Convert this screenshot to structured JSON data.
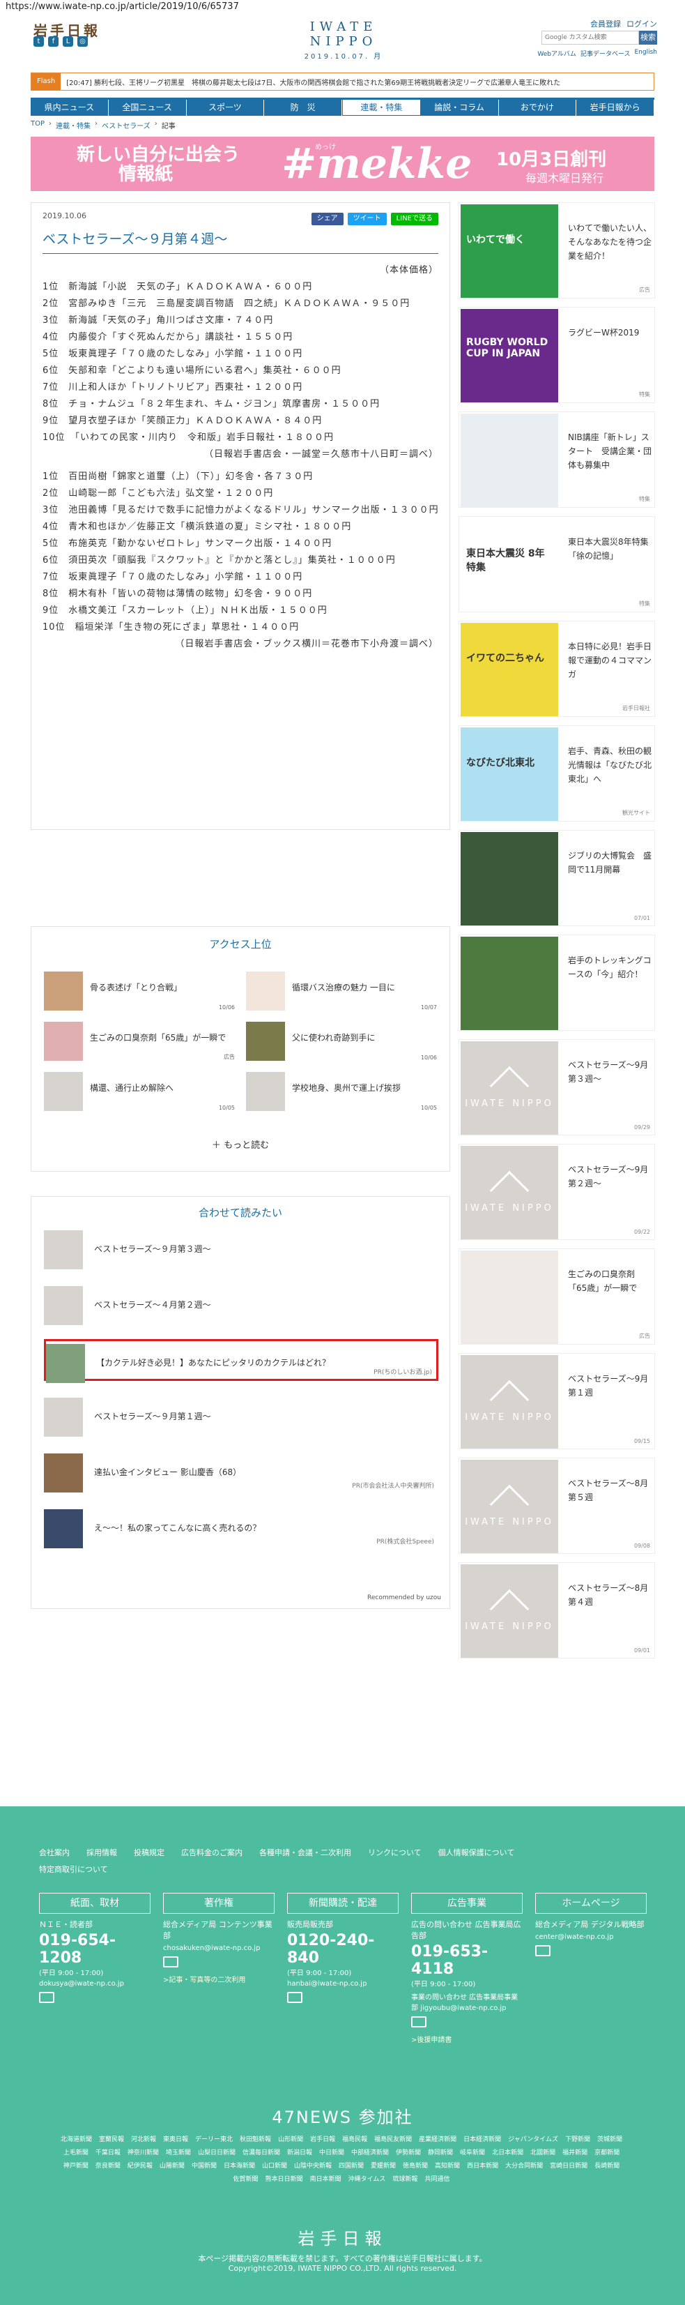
{
  "url": "https://www.iwate-np.co.jp/article/2019/10/6/65737",
  "header": {
    "logo_left": "岩手日報",
    "logo_center": "IWATE NIPPO",
    "date_line": "2019.10.07. 月",
    "register": "会員登録",
    "login": "ログイン",
    "search_placeholder": "Google カスタム検索",
    "search_button": "検索",
    "web_album": "Webアルバム",
    "news_db": "記事データベース",
    "eng": "English"
  },
  "ticker": {
    "label": "Flash",
    "time": "[20:47]",
    "text": "勝利七段、王将リーグ初黒星　将棋の藤井聡太七段は7日、大阪市の関西将棋会館で指された第69期王将戦挑戦者決定リーグで広瀬章人竜王に敗れた"
  },
  "nav": [
    "県内ニュース",
    "全国ニュース",
    "スポーツ",
    "防　災",
    "連載・特集",
    "論説・コラム",
    "おでかけ",
    "岩手日報から"
  ],
  "breadcrumb": [
    "TOP",
    "連載・特集",
    "ベストセラーズ",
    "記事"
  ],
  "banner": {
    "left1": "新しい自分に出会う",
    "left2": "情報紙",
    "mekke": "#mekke",
    "mekke_kana": "めっけ",
    "right": "10月3日創刊",
    "right2": "毎週木曜日発行"
  },
  "article": {
    "date": "2019.10.06",
    "share_fb": "シェア",
    "share_tw": "ツイート",
    "share_line": "LINEで送る",
    "title": "ベストセラーズ～９月第４週～",
    "note": "（本体価格）",
    "lines_a": [
      "1位　新海誠「小説　天気の子」ＫＡＤＯＫＡＷＡ・６００円",
      "2位　宮部みゆき「三元　三島屋変調百物語　四之続」ＫＡＤＯＫＡＷＡ・９５０円",
      "3位　新海誠「天気の子」角川つばさ文庫・７４０円",
      "4位　内藤俊介「すぐ死ぬんだから」講談社・１５５０円",
      "5位　坂東眞理子「７０歳のたしなみ」小学館・１１００円",
      "6位　矢部和幸「どこよりも遠い場所にいる君へ」集英社・６００円",
      "7位　川上和人ほか「トリノトリビア」西東社・１２００円",
      "8位　チョ・ナムジュ「８２年生まれ、キム・ジヨン」筑摩書房・１５００円",
      "9位　望月衣塑子ほか「笑顔正力」ＫＡＤＯＫＡＷＡ・８４０円",
      "10位　「いわての民家・川内り　令和版」岩手日報社・１８００円"
    ],
    "source_a": "（日報岩手書店会・一誠堂＝久慈市十八日町＝調べ）",
    "lines_b": [
      "1位　百田尚樹「錦家と道璽（上）（下）」幻冬舎・各７３０円",
      "2位　山崎聡一郎「こども六法」弘文堂・１２００円",
      "3位　池田義博「見るだけで数手に記憶力がよくなるドリル」サンマーク出版・１３００円",
      "4位　青木和也ほか／佐藤正文「横浜鉄道の夏」ミシマ社・１８００円",
      "5位　布施英克「勤かないゼロトレ」サンマーク出版・１４００円",
      "6位　須田英次「頭脳我『スクワット』と『かかと落とし』」集英社・１０００円",
      "7位　坂東眞理子「７０歳のたしなみ」小学館・１１００円",
      "8位　桐木有朴「皆いの荷物は薄情の眩物」幻冬舎・９００円",
      "9位　水橋文美江「スカーレット（上）」ＮＨＫ出版・１５００円",
      "10位　稲垣栄洋「生き物の死にざま」草思社・１４００円"
    ],
    "source_b": "（日報岩手書店会・ブックス横川＝花巻市下小舟渡＝調べ）"
  },
  "sidebar": [
    {
      "title": "いわてで働いたい人、そんなあなたを待つ企業を紹介！",
      "src": "広告",
      "bg": "#2f9e4a",
      "img_text": "いわてで働く"
    },
    {
      "title": "ラグビーW杯2019",
      "src": "特集",
      "bg": "#6a2a8c",
      "img_text": "RUGBY WORLD CUP IN JAPAN"
    },
    {
      "title": "NIB講座「新トレ」スタート　受講企業・団体も募集中",
      "src": "特集",
      "bg": "#e9eef3",
      "img_text": ""
    },
    {
      "title": "東日本大震災8年特集「徐の記憶」",
      "src": "特集",
      "bg": "#ffffff",
      "img_text": "東日本大震災 8年特集"
    },
    {
      "title": "本日特に必見！岩手日報で運動の４コママンガ",
      "src": "岩手日報社",
      "bg": "#f0d93a",
      "img_text": "イワての二ちゃん"
    },
    {
      "title": "岩手、青森、秋田の観光情報は「なびたび北東北」へ",
      "src": "観光サイト",
      "bg": "#aee0f2",
      "img_text": "なびたび北東北"
    },
    {
      "title": "ジブリの大博覧会　盛岡で11月開幕",
      "src": "07/01",
      "bg": "#3a5a3a",
      "img_text": ""
    },
    {
      "title": "岩手のトレッキングコースの「今」紹介！",
      "src": "",
      "bg": "#4d7a3e",
      "img_text": ""
    },
    {
      "title": "ベストセラーズ～9月第３週～",
      "src": "09/29",
      "bg": "",
      "img_text": "IWATE NIPPO"
    },
    {
      "title": "ベストセラーズ～9月第２週～",
      "src": "09/22",
      "bg": "",
      "img_text": "IWATE NIPPO"
    },
    {
      "title": "生ごみの口臭奈剤「65歳」が一瞬で",
      "src": "広告",
      "bg": "#efeae6",
      "img_text": ""
    },
    {
      "title": "ベストセラーズ～9月第１週",
      "src": "09/15",
      "bg": "",
      "img_text": "IWATE NIPPO"
    },
    {
      "title": "ベストセラーズ～8月第５週",
      "src": "09/08",
      "bg": "",
      "img_text": "IWATE NIPPO"
    },
    {
      "title": "ベストセラーズ～8月第４週",
      "src": "09/01",
      "bg": "",
      "img_text": "IWATE NIPPO"
    }
  ],
  "access": {
    "title": "アクセス上位",
    "items": [
      {
        "t": "骨る表述げ「とり合戦」",
        "d": "10/06"
      },
      {
        "t": "循環バス治療の魅力 一目に",
        "d": "10/07"
      },
      {
        "t": "生ごみの口臭奈剤「65歳」が一瞬で",
        "d": "広告"
      },
      {
        "t": "父に使われ奇跡到手に",
        "d": "10/06"
      },
      {
        "t": "構還、通行止め解除へ",
        "d": "10/05"
      },
      {
        "t": "学校地身、奥州で運上げ挨拶",
        "d": "10/05"
      }
    ],
    "more": "もっと読む"
  },
  "related": {
    "title": "合わせて読みたい",
    "items": [
      {
        "t": "ベストセラーズ～９月第３週～",
        "pr": ""
      },
      {
        "t": "ベストセラーズ～４月第２週～",
        "pr": ""
      },
      {
        "t": "【カクテル好き必見！】あなたにピッタリのカクテルはどれ？",
        "pr": "PR(ちのしいお酒.jp)"
      },
      {
        "t": "ベストセラーズ～９月第１週～",
        "pr": ""
      },
      {
        "t": "達払い金インタビュー 影山慶香（68）",
        "pr": "PR(市会会社法人中央審判所)"
      },
      {
        "t": "え～～！私の家ってこんなに高く売れるの？",
        "pr": "PR(株式会社Speee)"
      }
    ],
    "rec": "Recommended by uzou"
  },
  "footer": {
    "links": [
      "会社案内",
      "採用情報",
      "投稿規定",
      "広告料金のご案内",
      "各種申請・会議・二次利用",
      "リンクについて",
      "個人情報保護について",
      "特定商取引について"
    ],
    "cols": [
      {
        "h": "紙面、取材",
        "s": "ＮＩＥ・読者部",
        "ph": "019-654-1208",
        "t": "(平日 9:00 - 17:00)",
        "em": "dokusya@iwate-np.co.jp",
        "lk": ""
      },
      {
        "h": "著作権",
        "s": "総合メディア局 コンテンツ事業部",
        "ph": "",
        "t": "",
        "em": "chosakuken@iwate-np.co.jp",
        "lk": ">記事・写真等の二次利用"
      },
      {
        "h": "新聞購読・配達",
        "s": "販売局販売部",
        "ph": "0120-240-840",
        "t": "(平日 9:00 - 17:00)",
        "em": "hanbai@iwate-np.co.jp",
        "lk": ""
      },
      {
        "h": "広告事業",
        "s": "広告の問い合わせ 広告事業局広告部",
        "ph": "019-653-4118",
        "t": "(平日 9:00 - 17:00)",
        "em": "事業の問い合わせ 広告事業局事業部 jigyoubu@iwate-np.co.jp",
        "lk": ">後援申請書"
      },
      {
        "h": "ホームページ",
        "s": "総合メディア局 デジタル戦略部",
        "ph": "",
        "t": "",
        "em": "center@iwate-np.co.jp",
        "lk": ""
      }
    ],
    "n47": "47NEWS 参加社",
    "papers": [
      "北海道新聞",
      "室蘭民報",
      "河北新報",
      "東奥日報",
      "デーリー東北",
      "秋田魁新報",
      "山形新聞",
      "岩手日報",
      "福島民報",
      "福島民友新聞",
      "産業経済新聞",
      "日本経済新聞",
      "ジャパンタイムズ",
      "下野新聞",
      "茨城新聞",
      "上毛新聞",
      "千葉日報",
      "神奈川新聞",
      "埼玉新聞",
      "山梨日日新聞",
      "信濃毎日新聞",
      "新潟日報",
      "中日新聞",
      "中部経済新聞",
      "伊勢新聞",
      "静岡新聞",
      "岐阜新聞",
      "北日本新聞",
      "北國新聞",
      "福井新聞",
      "京都新聞",
      "神戸新聞",
      "奈良新聞",
      "紀伊民報",
      "山陽新聞",
      "中国新聞",
      "日本海新聞",
      "山口新聞",
      "山陰中央新報",
      "四国新聞",
      "愛媛新聞",
      "徳島新聞",
      "高知新聞",
      "西日本新聞",
      "大分合同新聞",
      "宮崎日日新聞",
      "長崎新聞",
      "佐賀新聞",
      "熊本日日新聞",
      "南日本新聞",
      "沖縄タイムス",
      "琉球新報",
      "共同通信"
    ],
    "logo": "岩手日報",
    "note": "本ページ掲載内容の無断転載を禁じます。すべての著作権は岩手日報社に属します。",
    "copy": "Copyright©2019, IWATE NIPPO CO.,LTD. All rights reserved."
  }
}
